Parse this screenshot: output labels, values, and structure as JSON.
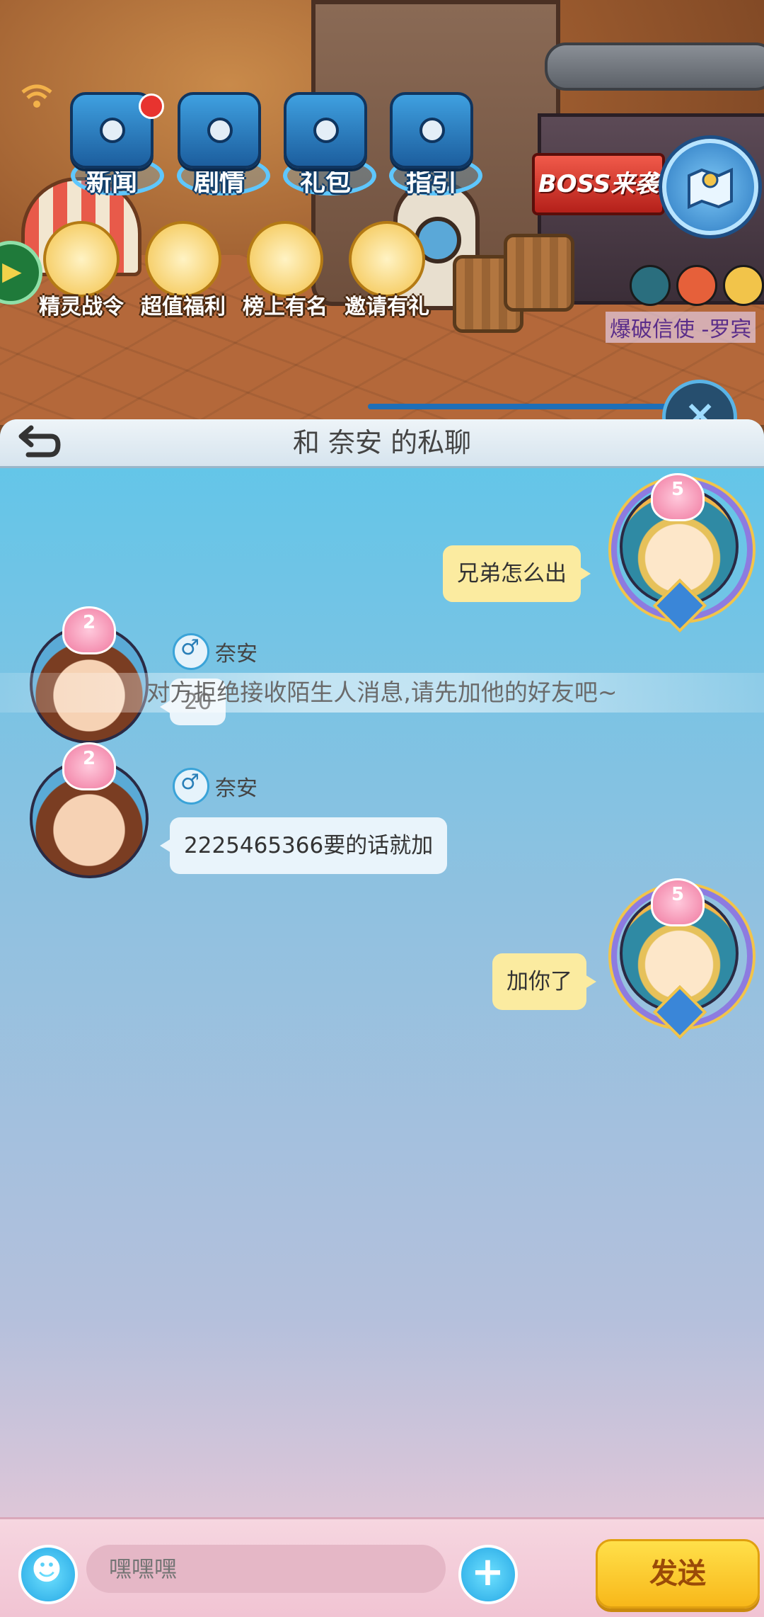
{
  "scene": {
    "menu": [
      "新闻",
      "剧情",
      "礼包",
      "指引"
    ],
    "events": [
      "精灵战令",
      "超值福利",
      "榜上有名",
      "邀请有礼"
    ],
    "boss_label": "BOSS来袭",
    "status_text": "爆破信使 -罗宾",
    "icons": [
      "wifi-icon",
      "map-icon",
      "play-icon",
      "close-icon"
    ]
  },
  "chat": {
    "title": "和 奈安 的私聊",
    "messages": [
      {
        "from": "me",
        "level": "5",
        "text": "兄弟怎么出"
      },
      {
        "from": "them",
        "level": "2",
        "name": "奈安",
        "text": "20"
      },
      {
        "from": "them",
        "level": "2",
        "name": "奈安",
        "text": "2225465366要的话就加"
      },
      {
        "from": "me",
        "level": "5",
        "text": "加你了"
      }
    ],
    "toast": "对方拒绝接收陌生人消息,请先加他的好友吧~"
  },
  "input": {
    "placeholder": "嘿嘿嘿",
    "send_label": "发送"
  },
  "colors": {
    "chat_bg_top": "#5fc6e9",
    "chat_bg_bottom": "#f2c9d6",
    "my_bubble": "#fbeba0",
    "their_bubble": "#e9f4fb",
    "send_button": "#f8b81a"
  }
}
